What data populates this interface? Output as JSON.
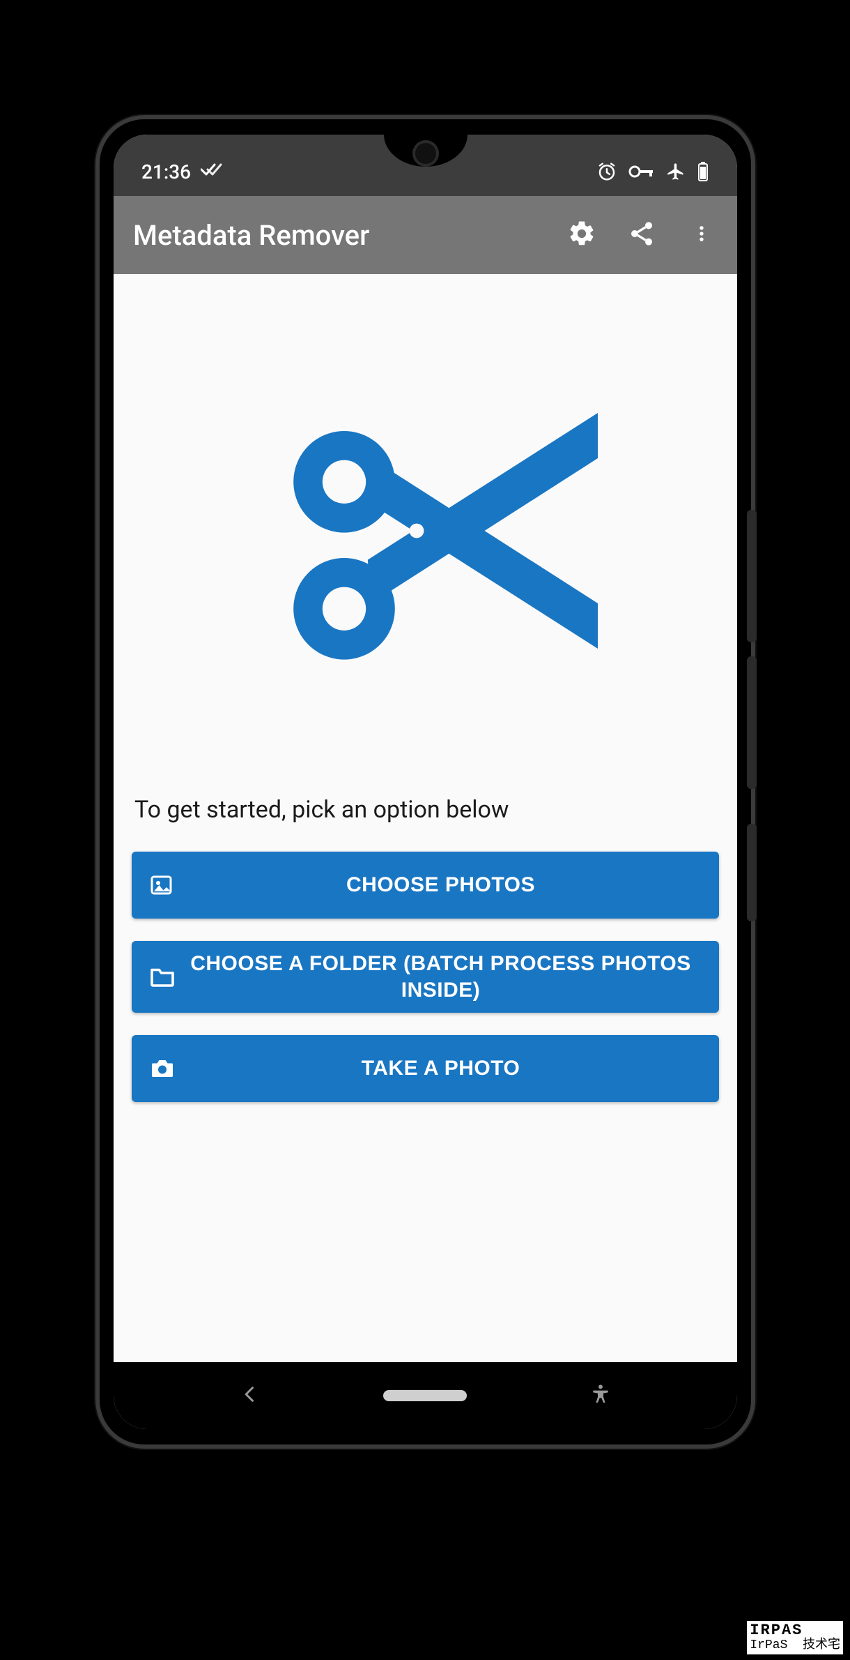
{
  "status": {
    "time": "21:36",
    "icons": {
      "left_stacked_check": "stacked-check-icon",
      "alarm": "alarm-icon",
      "vpn_key": "vpn-key-icon",
      "airplane": "airplane-icon",
      "battery": "battery-icon"
    }
  },
  "app_bar": {
    "title": "Metadata Remover",
    "actions": {
      "settings": "gear-icon",
      "share": "share-icon",
      "overflow": "more-vert-icon"
    }
  },
  "main": {
    "logo": "scissors-icon",
    "instruction": "To get started, pick an option below",
    "buttons": [
      {
        "key": "choose_photos",
        "icon": "image-icon",
        "label": "CHOOSE PHOTOS"
      },
      {
        "key": "choose_folder",
        "icon": "folder-icon",
        "label": "CHOOSE A FOLDER (BATCH PROCESS PHOTOS INSIDE)"
      },
      {
        "key": "take_photo",
        "icon": "camera-icon",
        "label": "TAKE A PHOTO"
      }
    ]
  },
  "nav": {
    "back": "back-icon",
    "home": "home-pill",
    "accessibility": "accessibility-icon"
  },
  "watermark": {
    "line1": "IRPAS",
    "line2": "IrPaS  技术宅"
  },
  "colors": {
    "accent": "#1976c3",
    "appbar": "#767676",
    "status": "#3d3d3d"
  }
}
